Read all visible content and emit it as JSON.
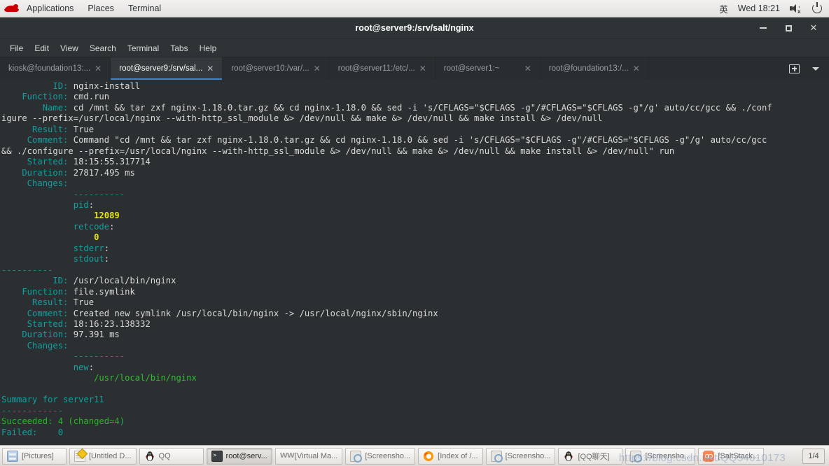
{
  "gnome_topbar": {
    "logo": "redhat-logo",
    "menus": [
      "Applications",
      "Places",
      "Terminal"
    ],
    "input_method": "英",
    "clock": "Wed 18:21",
    "volume_icon": "volume-muted-icon",
    "power_icon": "power-icon"
  },
  "window": {
    "title": "root@server9:/srv/salt/nginx",
    "minimize": "–",
    "maximize": "□",
    "close": "✕"
  },
  "menu_bar": [
    "File",
    "Edit",
    "View",
    "Search",
    "Terminal",
    "Tabs",
    "Help"
  ],
  "tabs": [
    {
      "label": "kiosk@foundation13:...",
      "active": false,
      "close": "✕"
    },
    {
      "label": "root@server9:/srv/sal...",
      "active": true,
      "close": "✕"
    },
    {
      "label": "root@server10:/var/...",
      "active": false,
      "close": "✕"
    },
    {
      "label": "root@server11:/etc/...",
      "active": false,
      "close": "✕"
    },
    {
      "label": "root@server1:~",
      "active": false,
      "close": "✕"
    },
    {
      "label": "root@foundation13:/...",
      "active": false,
      "close": "✕"
    }
  ],
  "tab_actions": {
    "new_tab": "new-tab-icon",
    "tab_list": "chevron-down-icon"
  },
  "terminal": {
    "lines": [
      {
        "segments": [
          {
            "t": "          ID: ",
            "c": "c-teal"
          },
          {
            "t": "nginx-install",
            "c": "c-white"
          }
        ]
      },
      {
        "segments": [
          {
            "t": "    Function: ",
            "c": "c-teal"
          },
          {
            "t": "cmd.run",
            "c": "c-white"
          }
        ]
      },
      {
        "segments": [
          {
            "t": "        Name: ",
            "c": "c-teal"
          },
          {
            "t": "cd /mnt && tar zxf nginx-1.18.0.tar.gz && cd nginx-1.18.0 && sed -i 's/CFLAGS=\"$CFLAGS -g\"/#CFLAGS=\"$CFLAGS -g\"/g' auto/cc/gcc && ./conf",
            "c": "c-white"
          }
        ]
      },
      {
        "segments": [
          {
            "t": "igure --prefix=/usr/local/nginx --with-http_ssl_module &> /dev/null && make &> /dev/null && make install &> /dev/null",
            "c": "c-white"
          }
        ]
      },
      {
        "segments": [
          {
            "t": "      Result: ",
            "c": "c-teal"
          },
          {
            "t": "True",
            "c": "c-white"
          }
        ]
      },
      {
        "segments": [
          {
            "t": "     Comment: ",
            "c": "c-teal"
          },
          {
            "t": "Command \"cd /mnt && tar zxf nginx-1.18.0.tar.gz && cd nginx-1.18.0 && sed -i 's/CFLAGS=\"$CFLAGS -g\"/#CFLAGS=\"$CFLAGS -g\"/g' auto/cc/gcc",
            "c": "c-white"
          }
        ]
      },
      {
        "segments": [
          {
            "t": "&& ./configure --prefix=/usr/local/nginx --with-http_ssl_module &> /dev/null && make &> /dev/null && make install &> /dev/null\" run",
            "c": "c-white"
          }
        ]
      },
      {
        "segments": [
          {
            "t": "     Started: ",
            "c": "c-teal"
          },
          {
            "t": "18:15:55.317714",
            "c": "c-white"
          }
        ]
      },
      {
        "segments": [
          {
            "t": "    Duration: ",
            "c": "c-teal"
          },
          {
            "t": "27817.495 ms",
            "c": "c-white"
          }
        ]
      },
      {
        "segments": [
          {
            "t": "     Changes:   ",
            "c": "c-teal"
          }
        ]
      },
      {
        "segments": [
          {
            "t": "              ----------",
            "c": "c-grey"
          }
        ]
      },
      {
        "segments": [
          {
            "t": "              pid",
            "c": "c-teal"
          },
          {
            "t": ":",
            "c": "c-white"
          }
        ]
      },
      {
        "segments": [
          {
            "t": "                  12089",
            "c": "c-yellow"
          }
        ]
      },
      {
        "segments": [
          {
            "t": "              retcode",
            "c": "c-teal"
          },
          {
            "t": ":",
            "c": "c-white"
          }
        ]
      },
      {
        "segments": [
          {
            "t": "                  0",
            "c": "c-yellow"
          }
        ]
      },
      {
        "segments": [
          {
            "t": "              stderr",
            "c": "c-teal"
          },
          {
            "t": ":",
            "c": "c-white"
          }
        ]
      },
      {
        "segments": [
          {
            "t": "              stdout",
            "c": "c-teal"
          },
          {
            "t": ":",
            "c": "c-white"
          }
        ]
      },
      {
        "segments": [
          {
            "t": "----------",
            "c": "c-grey"
          }
        ]
      },
      {
        "segments": [
          {
            "t": "          ID: ",
            "c": "c-teal"
          },
          {
            "t": "/usr/local/bin/nginx",
            "c": "c-white"
          }
        ]
      },
      {
        "segments": [
          {
            "t": "    Function: ",
            "c": "c-teal"
          },
          {
            "t": "file.symlink",
            "c": "c-white"
          }
        ]
      },
      {
        "segments": [
          {
            "t": "      Result: ",
            "c": "c-teal"
          },
          {
            "t": "True",
            "c": "c-white"
          }
        ]
      },
      {
        "segments": [
          {
            "t": "     Comment: ",
            "c": "c-teal"
          },
          {
            "t": "Created new symlink /usr/local/bin/nginx -> /usr/local/nginx/sbin/nginx",
            "c": "c-white"
          }
        ]
      },
      {
        "segments": [
          {
            "t": "     Started: ",
            "c": "c-teal"
          },
          {
            "t": "18:16:23.138332",
            "c": "c-white"
          }
        ]
      },
      {
        "segments": [
          {
            "t": "    Duration: ",
            "c": "c-teal"
          },
          {
            "t": "97.391 ms",
            "c": "c-white"
          }
        ]
      },
      {
        "segments": [
          {
            "t": "     Changes:   ",
            "c": "c-teal"
          }
        ]
      },
      {
        "segments": [
          {
            "t": "              ----------",
            "c": "c-grey"
          }
        ]
      },
      {
        "segments": [
          {
            "t": "              new",
            "c": "c-teal"
          },
          {
            "t": ":",
            "c": "c-white"
          }
        ]
      },
      {
        "segments": [
          {
            "t": "                  /usr/local/bin/nginx",
            "c": "c-greenlt"
          }
        ]
      },
      {
        "segments": [
          {
            "t": "",
            "c": "c-white"
          }
        ]
      },
      {
        "segments": [
          {
            "t": "Summary for server11",
            "c": "c-teal"
          }
        ]
      },
      {
        "segments": [
          {
            "t": "------------",
            "c": "c-grey"
          }
        ]
      },
      {
        "segments": [
          {
            "t": "Succeeded: 4 (changed=4)",
            "c": "c-green"
          }
        ]
      },
      {
        "segments": [
          {
            "t": "Failed:    0",
            "c": "c-teal"
          }
        ]
      }
    ]
  },
  "taskbar": {
    "items": [
      {
        "label": "[Pictures]",
        "icon": "files-icon",
        "active": false
      },
      {
        "label": "[Untitled D...",
        "icon": "notepad-icon",
        "active": false
      },
      {
        "label": "QQ",
        "icon": "qq-penguin-icon",
        "active": false
      },
      {
        "label": "root@serv...",
        "icon": "terminal-icon",
        "active": true
      },
      {
        "label": "[Virtual Ma...",
        "icon": "virtual-machine-icon",
        "active": false
      },
      {
        "label": "[Screensho...",
        "icon": "screenshot-icon",
        "active": false
      },
      {
        "label": "[Index of /...",
        "icon": "firefox-icon",
        "active": false
      },
      {
        "label": "[Screensho...",
        "icon": "screenshot-icon",
        "active": false
      },
      {
        "label": "[QQ聊天]",
        "icon": "qq-penguin-icon",
        "active": false
      },
      {
        "label": "[Screensho...",
        "icon": "screenshot-icon",
        "active": false
      },
      {
        "label": "[SaltStack...",
        "icon": "saltstack-icon",
        "active": false
      }
    ],
    "workspace_indicator": "1/4",
    "watermark": "https://blog.csdn.net/QQ54010173"
  }
}
